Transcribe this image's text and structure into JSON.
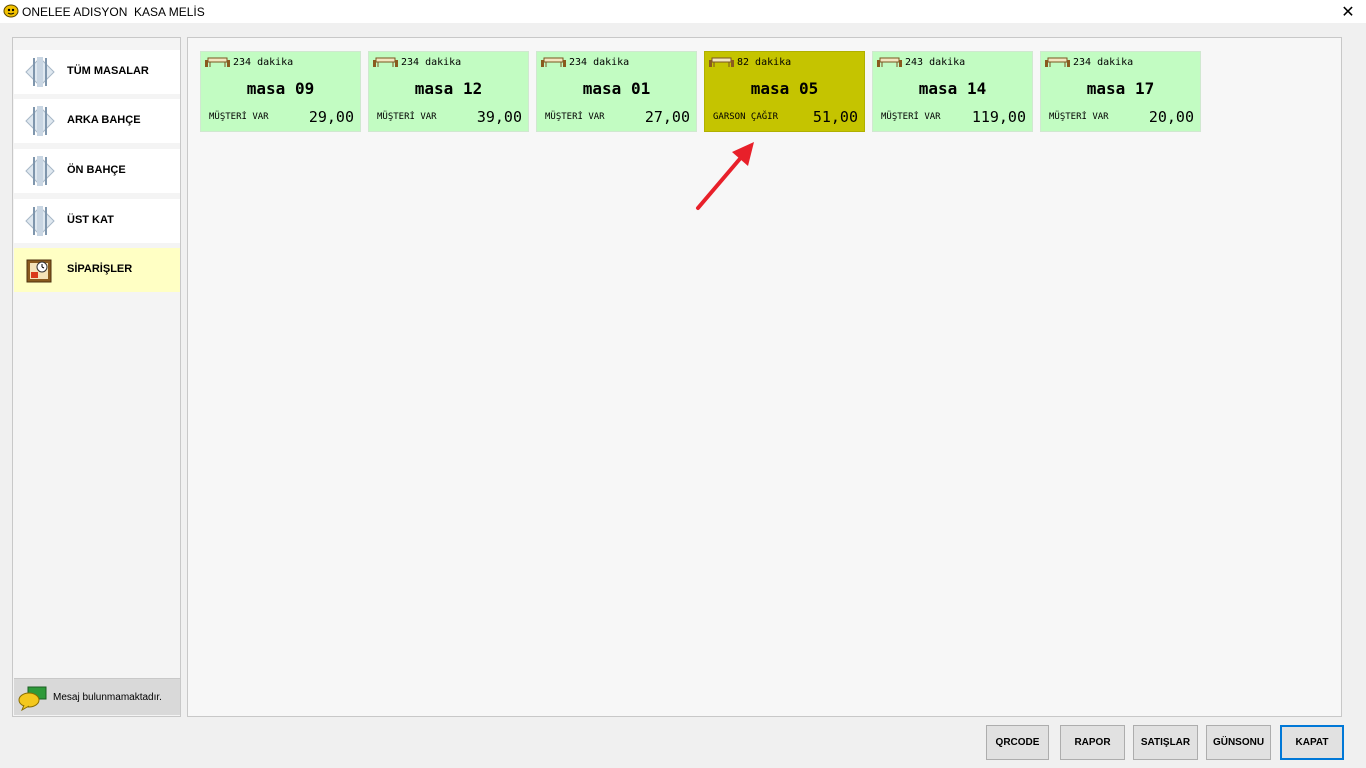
{
  "window": {
    "title": "ONELEE ADISYON  KASA MELİS",
    "close_glyph": "✕"
  },
  "sidebar": {
    "items": [
      {
        "label": "TÜM MASALAR",
        "icon": "cutlery-icon"
      },
      {
        "label": "ARKA BAHÇE",
        "icon": "cutlery-icon"
      },
      {
        "label": "ÖN BAHÇE",
        "icon": "cutlery-icon"
      },
      {
        "label": "ÜST KAT",
        "icon": "cutlery-icon"
      },
      {
        "label": "SİPARİŞLER",
        "icon": "orders-icon",
        "active": true
      }
    ],
    "message": "Mesaj bulunmamaktadır."
  },
  "tables": [
    {
      "time": "234 dakika",
      "name": "masa 09",
      "status": "MÜŞTERİ VAR",
      "amount": "29,00",
      "state": "occupied"
    },
    {
      "time": "234 dakika",
      "name": "masa 12",
      "status": "MÜŞTERİ VAR",
      "amount": "39,00",
      "state": "occupied"
    },
    {
      "time": "234 dakika",
      "name": "masa 01",
      "status": "MÜŞTERİ VAR",
      "amount": "27,00",
      "state": "occupied"
    },
    {
      "time": "82 dakika",
      "name": "masa 05",
      "status": "GARSON ÇAĞIR",
      "amount": "51,00",
      "state": "call-waiter"
    },
    {
      "time": "243 dakika",
      "name": "masa 14",
      "status": "MÜŞTERİ VAR",
      "amount": "119,00",
      "state": "occupied"
    },
    {
      "time": "234 dakika",
      "name": "masa 17",
      "status": "MÜŞTERİ VAR",
      "amount": "20,00",
      "state": "occupied"
    }
  ],
  "buttons": {
    "qrcode": "QRCODE",
    "rapor": "RAPOR",
    "satislar": "SATIŞLAR",
    "gunsonu": "GÜNSONU",
    "kapat": "KAPAT"
  },
  "colors": {
    "occupied": "#c2fcc2",
    "call_waiter": "#c5c400",
    "active_nav": "#ffffc4",
    "annotation_arrow": "#e8202a"
  }
}
